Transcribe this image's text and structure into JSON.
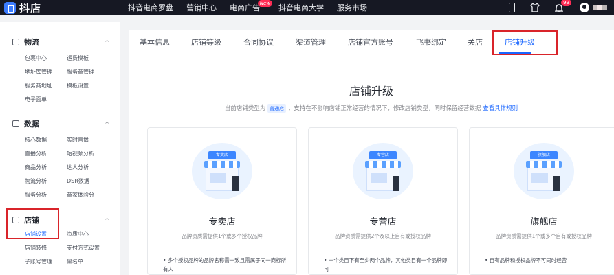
{
  "topbar": {
    "logo_text": "抖店",
    "nav": [
      "抖音电商罗盘",
      "营销中心",
      "电商广告",
      "抖音电商大学",
      "服务市场"
    ],
    "ad_badge": "New",
    "bell_count": "99",
    "icons": [
      "phone-icon",
      "shirt-icon",
      "bell-icon",
      "avatar-icon"
    ]
  },
  "sidebar": {
    "groups": [
      {
        "title": "物流",
        "icon": "truck-icon",
        "links": [
          "包裹中心",
          "运费模板",
          "地址库管理",
          "服务商管理",
          "服务商地址",
          "模板设置",
          "电子面单"
        ]
      },
      {
        "title": "数据",
        "icon": "chart-icon",
        "links": [
          "核心数据",
          "实时直播",
          "直播分析",
          "短视频分析",
          "商品分析",
          "达人分析",
          "物流分析",
          "DSR数据",
          "服务分析",
          "商家体验分"
        ]
      },
      {
        "title": "店铺",
        "icon": "store-icon",
        "links": [
          "店铺设置",
          "资质中心",
          "店铺装修",
          "支付方式设置",
          "子账号管理",
          "黑名单"
        ]
      }
    ],
    "caret": "^"
  },
  "tabs": [
    "基本信息",
    "店铺等级",
    "合同协议",
    "渠道管理",
    "店铺官方账号",
    "飞书绑定",
    "关店",
    "店铺升级"
  ],
  "active_tab": "店铺升级",
  "page": {
    "title": "店铺升级",
    "desc_prefix": "当前店铺类型为",
    "current_type": "普通店",
    "desc_suffix": "，支持在不影响店铺正常经营的情况下，修改店铺类型，同时保留经营数据",
    "desc_link": "查看具体规则"
  },
  "cards": [
    {
      "sign": "专卖店",
      "title": "专卖店",
      "sub": "品牌资质需提供1个或多个授权品牌",
      "bullet": "• 多个授权品牌的品牌名称需一致且需属于同一商标所有人"
    },
    {
      "sign": "专营店",
      "title": "专营店",
      "sub": "品牌资质需提供2个及以上自有或授权品牌",
      "bullet": "• 一个类目下有至少两个品牌，其他类目有一个品牌即可"
    },
    {
      "sign": "旗舰店",
      "title": "旗舰店",
      "sub": "品牌资质需提供1个或多个自有或授权品牌",
      "bullet": "• 自有品牌和授权品牌不可同时经营"
    }
  ],
  "colors": {
    "accent": "#1966ff",
    "highlight": "#d9242a",
    "topbar": "#161823"
  }
}
